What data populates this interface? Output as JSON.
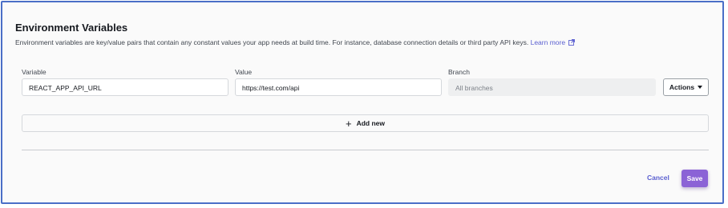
{
  "section": {
    "title": "Environment Variables",
    "description": "Environment variables are key/value pairs that contain any constant values your app needs at build time. For instance, database connection details or third party API keys.",
    "learn_more": "Learn more"
  },
  "variables": {
    "columns": {
      "variable": "Variable",
      "value": "Value",
      "branch": "Branch"
    },
    "rows": [
      {
        "variable": "REACT_APP_API_URL",
        "value": "https://test.com/api",
        "branch": "All branches"
      }
    ],
    "actions_label": "Actions"
  },
  "add_new_label": "Add new",
  "footer": {
    "cancel_label": "Cancel",
    "save_label": "Save"
  },
  "colors": {
    "accent": "#5a5fd0",
    "primary_button": "#8b63d6",
    "frame_border": "#4a6fc7"
  },
  "icons": {
    "learn_more": "external-link-icon",
    "actions": "caret-down-icon",
    "add_new": "plus-icon"
  }
}
